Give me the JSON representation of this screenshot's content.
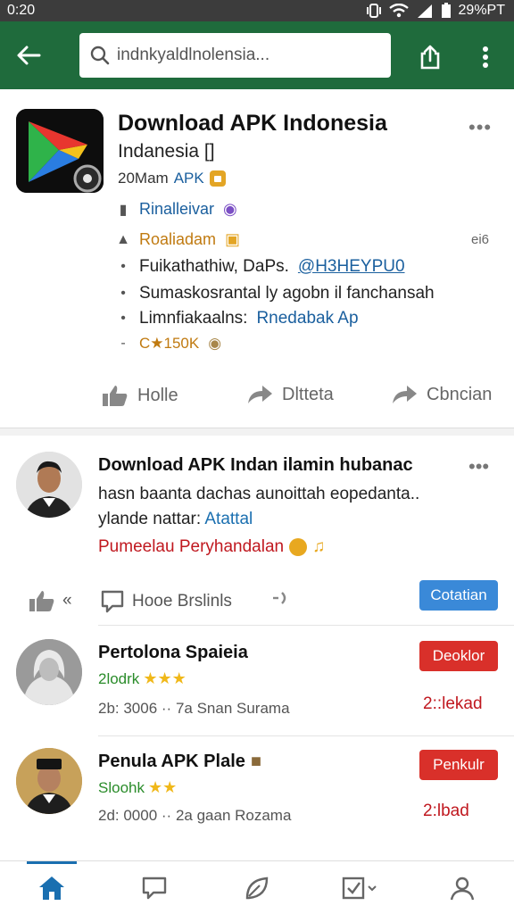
{
  "status": {
    "time": "0:20",
    "battery": "29%PT"
  },
  "search": {
    "value": "indnkyaldlnolensia..."
  },
  "app": {
    "title": "Download APK Indonesia",
    "subtitle": "Indanesia []",
    "meta_prefix": "20Mam",
    "meta_apk": "APK",
    "row1": "Rinalleivar",
    "row2": "Roaliadam",
    "row2_right": "ei6",
    "row3_text": "Fuikathathiw, DaPs.",
    "row3_link": "@H3HEYPU0",
    "row4": "Sumaskosrantal ly agobn il fanchansah",
    "row5_text": "Limnfiakaalns:",
    "row5_link": "Rnedabak Ap",
    "row6": "C★150K"
  },
  "actions": {
    "like": "Holle",
    "comment": "Dltteta",
    "share": "Cbncian"
  },
  "post": {
    "title": "Download APK Indan ilamin hubanac",
    "body_line1": "hasn baanta dachas aunoittah eopedanta..",
    "body_line2": "ylande nattar:",
    "body_link": "Atattal",
    "tag": "Pumeelau Peryhandalan",
    "like_suffix": "«",
    "reply_label": "Hooe Brslinls",
    "contact_label": "Cotatian"
  },
  "people": [
    {
      "name": "Pertolona Spaieia",
      "rating": "2lodrk",
      "meta": "2b: 3006 ·· 7a Snan Surama",
      "button": "Deoklor",
      "status": "2::lekad"
    },
    {
      "name": "Penula APK Plale",
      "rating": "Sloohk",
      "meta": "2d: 0000 ·· 2a gaan Rozama",
      "button": "Penkulr",
      "status": "2:lbad"
    }
  ],
  "colors": {
    "appbar": "#1f6b3c",
    "accent_blue": "#3a89d8",
    "danger": "#d9302a",
    "star": "#f0b81a"
  }
}
